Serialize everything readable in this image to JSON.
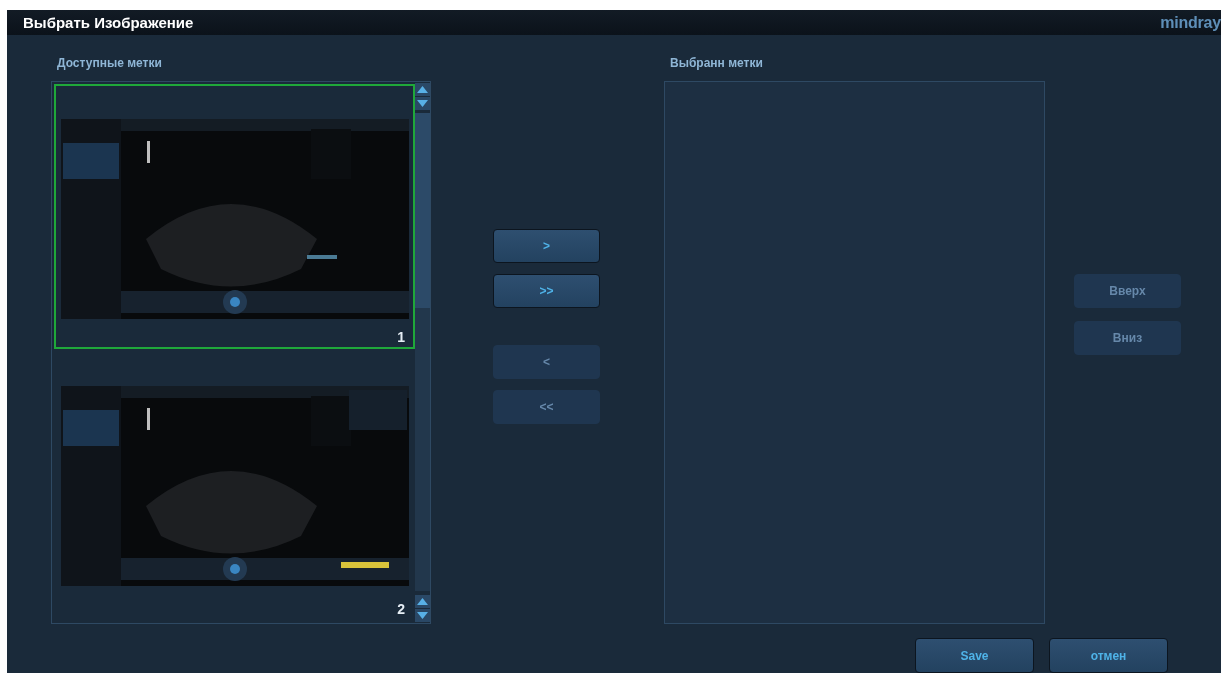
{
  "window": {
    "title": "Выбрать Изображение",
    "logo": "mindray"
  },
  "available": {
    "label": "Доступные метки",
    "thumbnails": [
      {
        "number": "1",
        "selected": true,
        "kind": "picture"
      },
      {
        "number": "2",
        "selected": false,
        "kind": "picture"
      }
    ]
  },
  "transfer_buttons": [
    {
      "label": ">",
      "disabled": false
    },
    {
      "label": ">>",
      "disabled": false
    },
    {
      "label": "<",
      "disabled": true
    },
    {
      "label": "<<",
      "disabled": true
    }
  ],
  "selected_panel": {
    "label": "Выбранн метки"
  },
  "order_buttons": [
    {
      "label": "Вверх",
      "disabled": true
    },
    {
      "label": "Вниз",
      "disabled": true
    }
  ],
  "footer_buttons": [
    {
      "label": "Save"
    },
    {
      "label": "отмен"
    }
  ]
}
